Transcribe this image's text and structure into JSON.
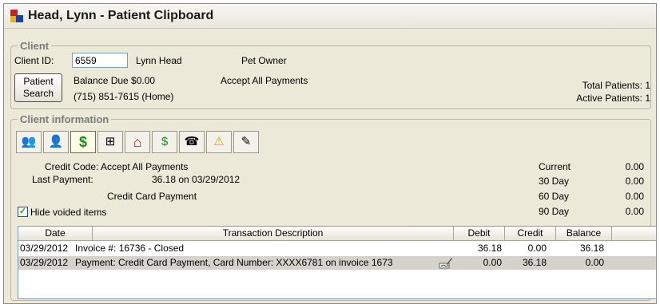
{
  "window": {
    "title": "Head, Lynn - Patient Clipboard"
  },
  "client": {
    "legend": "Client",
    "client_id_label": "Client ID:",
    "client_id_value": "6559",
    "client_name": "Lynn Head",
    "role": "Pet Owner",
    "patient_search_line1": "Patient",
    "patient_search_line2": "Search",
    "balance_due": "Balance Due  $0.00",
    "payment_policy": "Accept All Payments",
    "phone": "(715) 851-7615    (Home)",
    "total_patients_label": "Total Patients:",
    "total_patients_value": "1",
    "active_patients_label": "Active Patients:",
    "active_patients_value": "1"
  },
  "client_info": {
    "legend": "Client information",
    "toolbar_icons": [
      "people-icon",
      "person-icon",
      "dollar-icon",
      "calculator-icon",
      "house-icon",
      "invoice-dollar-icon",
      "phone-icon",
      "warning-icon",
      "notes-icon"
    ],
    "toolbar_glyphs": [
      "👥",
      "👤",
      "$",
      "⊞",
      "⌂",
      "$",
      "☎",
      "⚠",
      "✎"
    ],
    "credit_code": "Credit Code: Accept All Payments",
    "last_payment_label": "Last Payment:",
    "last_payment_value": "36.18  on  03/29/2012",
    "last_payment_method": "Credit Card Payment",
    "hide_voided_label": "Hide voided items",
    "hide_voided_checked": true,
    "aging": [
      {
        "label": "Current",
        "value": "0.00"
      },
      {
        "label": "30 Day",
        "value": "0.00"
      },
      {
        "label": "60 Day",
        "value": "0.00"
      },
      {
        "label": "90 Day",
        "value": "0.00"
      }
    ]
  },
  "transactions": {
    "columns": [
      "Date",
      "Transaction Description",
      "Debit",
      "Credit",
      "Balance"
    ],
    "rows": [
      {
        "date": "03/29/2012",
        "description": "Invoice #: 16736 - Closed",
        "debit": "36.18",
        "credit": "0.00",
        "balance": "36.18",
        "selected": false
      },
      {
        "date": "03/29/2012",
        "description": "Payment: Credit Card Payment, Card Number: XXXX6781 on invoice 1673",
        "debit": "0.00",
        "credit": "36.18",
        "balance": "0.00",
        "selected": true,
        "icon": "signature-icon"
      }
    ]
  },
  "colors": {
    "window_bg": "#ece9d8",
    "selected_row": "#d4d2cb",
    "legend_text": "#7a7a7a"
  }
}
